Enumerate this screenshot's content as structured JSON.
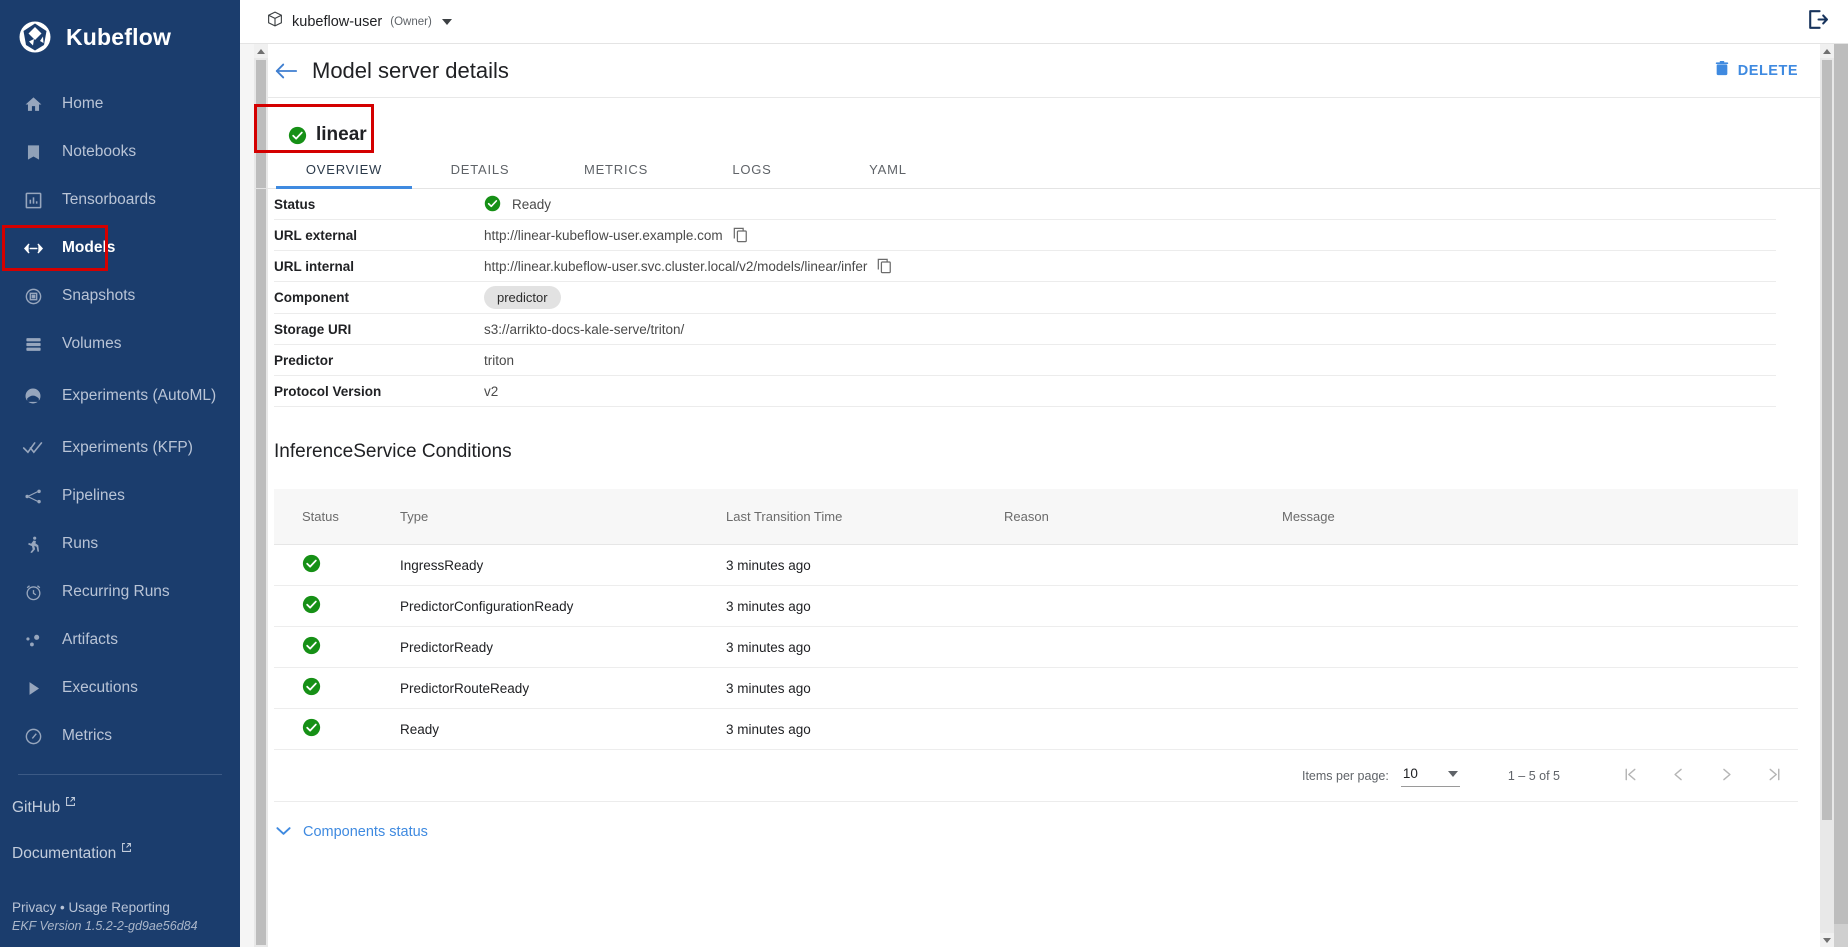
{
  "sidebar": {
    "brand": "Kubeflow",
    "items": [
      {
        "label": "Home",
        "icon": "home-icon",
        "active": false
      },
      {
        "label": "Notebooks",
        "icon": "notebook-icon",
        "active": false
      },
      {
        "label": "Tensorboards",
        "icon": "chart-icon",
        "active": false
      },
      {
        "label": "Models",
        "icon": "code-brackets-icon",
        "active": true
      },
      {
        "label": "Snapshots",
        "icon": "snapshot-icon",
        "active": false
      },
      {
        "label": "Volumes",
        "icon": "storage-icon",
        "active": false
      },
      {
        "label": "Experiments (AutoML)",
        "icon": "experiment-icon",
        "active": false
      },
      {
        "label": "Experiments (KFP)",
        "icon": "double-check-icon",
        "active": false
      },
      {
        "label": "Pipelines",
        "icon": "pipeline-icon",
        "active": false
      },
      {
        "label": "Runs",
        "icon": "runner-icon",
        "active": false
      },
      {
        "label": "Recurring Runs",
        "icon": "alarm-clock-icon",
        "active": false
      },
      {
        "label": "Artifacts",
        "icon": "artifact-icon",
        "active": false
      },
      {
        "label": "Executions",
        "icon": "play-triangle-icon",
        "active": false
      },
      {
        "label": "Metrics",
        "icon": "gauge-icon",
        "active": false
      }
    ],
    "external_links": [
      {
        "label": "GitHub",
        "icon": "external-link-icon"
      },
      {
        "label": "Documentation",
        "icon": "external-link-icon"
      }
    ],
    "footer": {
      "privacy": "Privacy",
      "separator": "•",
      "usage_reporting": "Usage Reporting",
      "version": "EKF Version 1.5.2-2-gd9ae56d84"
    }
  },
  "topbar": {
    "namespace_icon": "package-icon",
    "namespace": "kubeflow-user",
    "role": "(Owner)",
    "logout_icon": "logout-icon"
  },
  "page": {
    "back_icon": "arrow-left-icon",
    "title": "Model server details",
    "delete_icon": "trash-icon",
    "delete_label": "DELETE"
  },
  "model": {
    "status_icon": "check-circle-icon",
    "name": "linear"
  },
  "tabs": [
    {
      "label": "OVERVIEW",
      "active": true
    },
    {
      "label": "DETAILS",
      "active": false
    },
    {
      "label": "METRICS",
      "active": false
    },
    {
      "label": "LOGS",
      "active": false
    },
    {
      "label": "YAML",
      "active": false
    }
  ],
  "overview": {
    "rows": [
      {
        "key": "Status",
        "value": "Ready",
        "type": "status"
      },
      {
        "key": "URL external",
        "value": "http://linear-kubeflow-user.example.com",
        "type": "copy"
      },
      {
        "key": "URL internal",
        "value": "http://linear.kubeflow-user.svc.cluster.local/v2/models/linear/infer",
        "type": "copy"
      },
      {
        "key": "Component",
        "value": "predictor",
        "type": "chip"
      },
      {
        "key": "Storage URI",
        "value": "s3://arrikto-docs-kale-serve/triton/",
        "type": "text"
      },
      {
        "key": "Predictor",
        "value": "triton",
        "type": "text"
      },
      {
        "key": "Protocol Version",
        "value": "v2",
        "type": "text"
      }
    ]
  },
  "conditions": {
    "title": "InferenceService Conditions",
    "columns": [
      "Status",
      "Type",
      "Last Transition Time",
      "Reason",
      "Message"
    ],
    "rows": [
      {
        "status_icon": "check-circle-icon",
        "type": "IngressReady",
        "last_transition_time": "3 minutes ago",
        "reason": "",
        "message": ""
      },
      {
        "status_icon": "check-circle-icon",
        "type": "PredictorConfigurationReady",
        "last_transition_time": "3 minutes ago",
        "reason": "",
        "message": ""
      },
      {
        "status_icon": "check-circle-icon",
        "type": "PredictorReady",
        "last_transition_time": "3 minutes ago",
        "reason": "",
        "message": ""
      },
      {
        "status_icon": "check-circle-icon",
        "type": "PredictorRouteReady",
        "last_transition_time": "3 minutes ago",
        "reason": "",
        "message": ""
      },
      {
        "status_icon": "check-circle-icon",
        "type": "Ready",
        "last_transition_time": "3 minutes ago",
        "reason": "",
        "message": ""
      }
    ]
  },
  "paginator": {
    "items_per_page_label": "Items per page:",
    "items_per_page_value": "10",
    "range_label": "1 – 5 of 5",
    "first_icon": "first-page-icon",
    "prev_icon": "previous-page-icon",
    "next_icon": "next-page-icon",
    "last_icon": "last-page-icon"
  },
  "components_status": {
    "chevron_icon": "chevron-down-icon",
    "label": "Components status"
  },
  "colors": {
    "sidebar_bg": "#1b3d6d",
    "accent_blue": "#3f8ae0",
    "success_green": "#169016",
    "highlight_red": "#d40000"
  }
}
